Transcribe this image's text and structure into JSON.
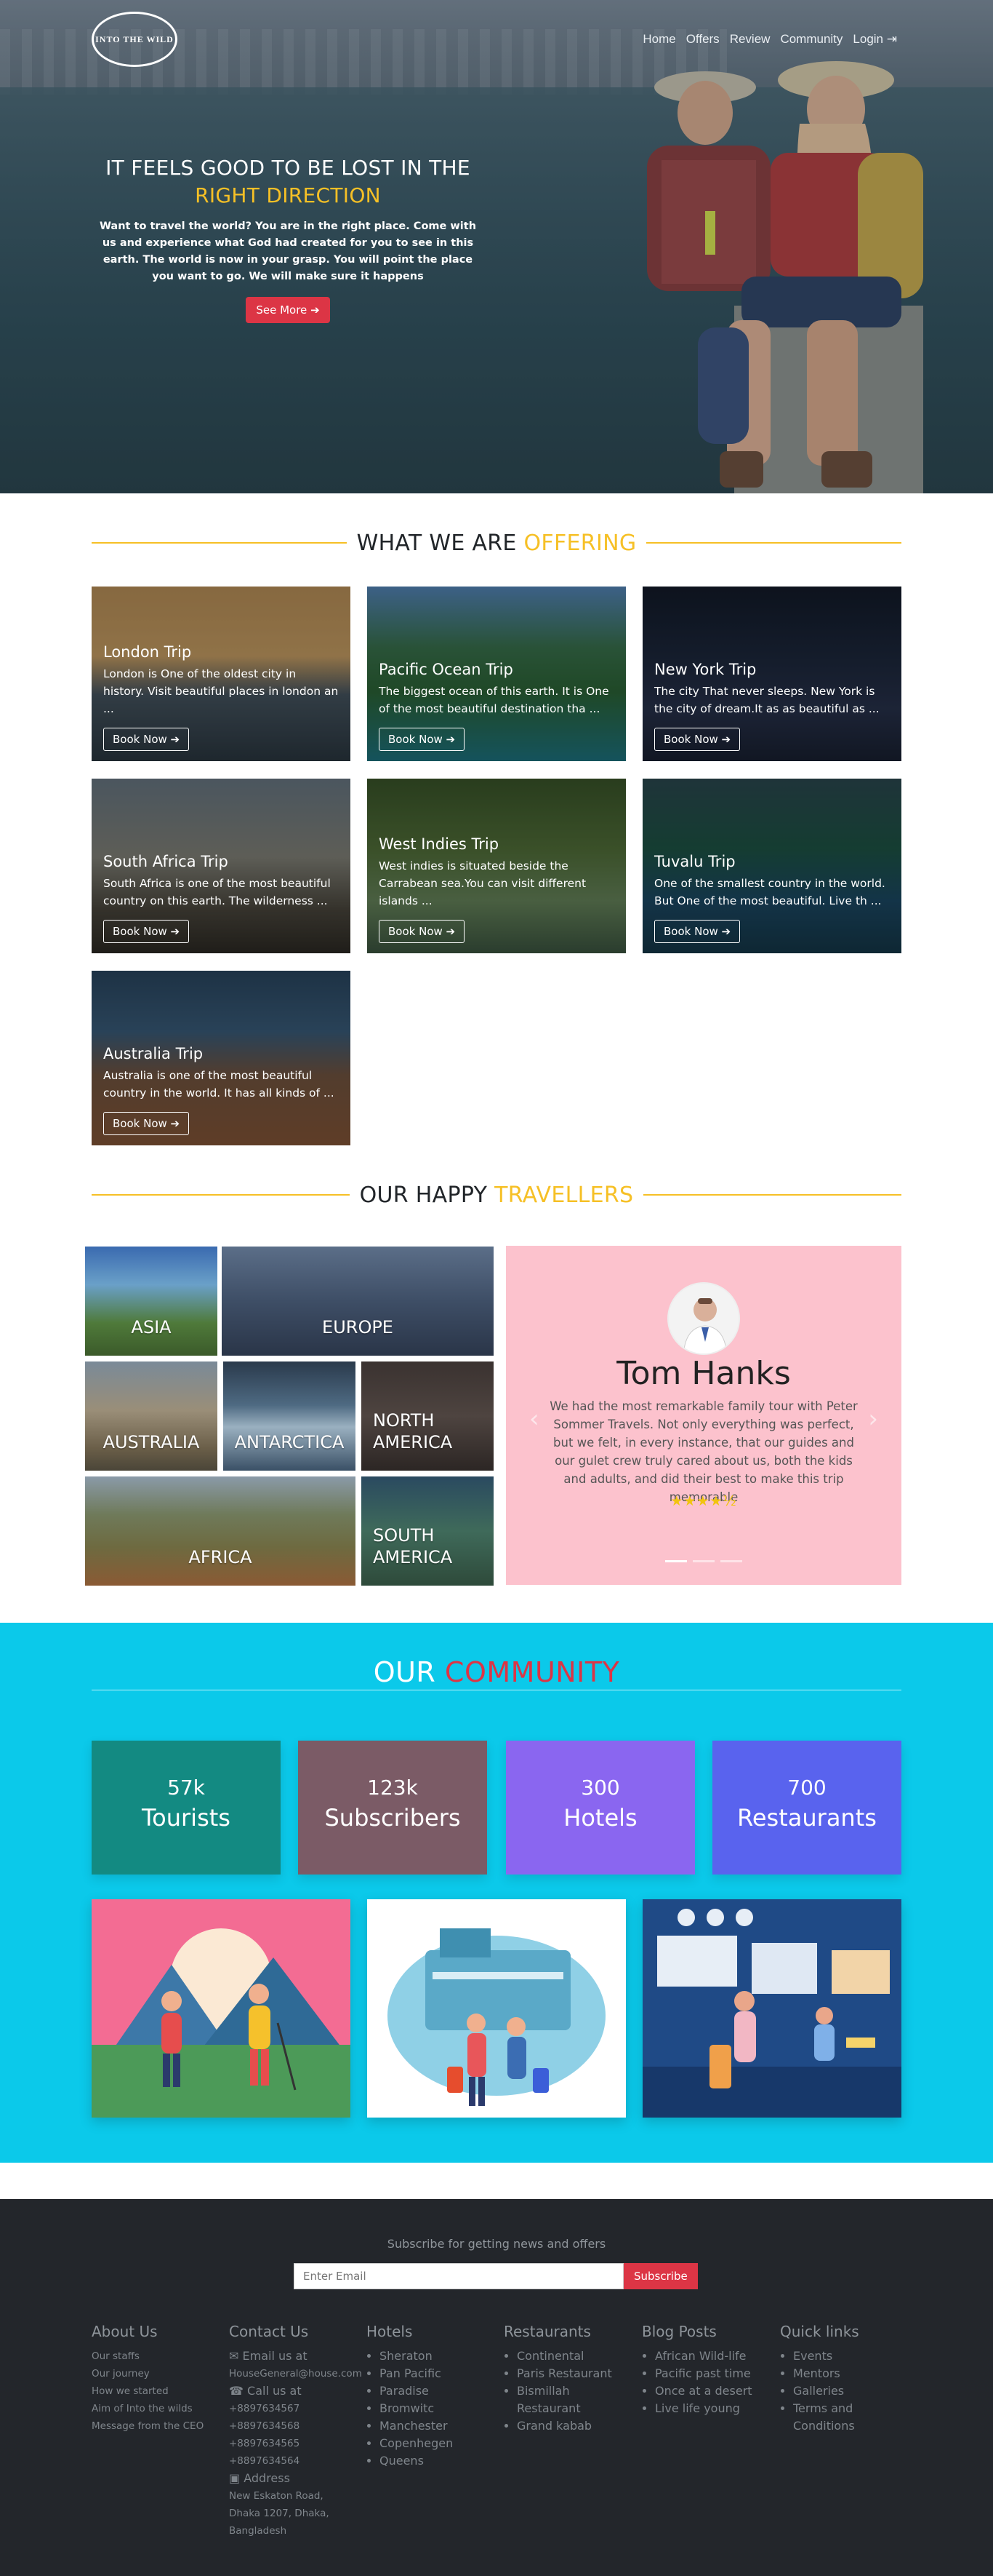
{
  "brand": {
    "logo_text": "INTO THE WILD"
  },
  "nav": {
    "items": [
      "Home",
      "Offers",
      "Review",
      "Community"
    ],
    "login": "Login"
  },
  "hero": {
    "title_line1": "IT FEELS GOOD TO BE LOST IN THE",
    "title_line2": "RIGHT DIRECTION",
    "description": "Want to travel the world? You are in the right place. Come with us and experience what God had created for you to see in this earth. The world is now in your grasp. You will point the place you want to go. We will make sure it happens",
    "button": "See More"
  },
  "offering": {
    "title_a": "WHAT WE ARE",
    "title_b": "OFFERING",
    "cards": [
      {
        "title": "London Trip",
        "desc": "London is One of the oldest city in history. Visit beautiful places in london an ...",
        "button": "Book Now"
      },
      {
        "title": "Pacific Ocean Trip",
        "desc": "The biggest ocean of this earth. It is One of the most beautiful destination tha ...",
        "button": "Book Now"
      },
      {
        "title": "New York Trip",
        "desc": "The city That never sleeps. New York is the city of dream.It as as beautiful as ...",
        "button": "Book Now"
      },
      {
        "title": "South Africa Trip",
        "desc": "South Africa is one of the most beautiful country on this earth. The wilderness ...",
        "button": "Book Now"
      },
      {
        "title": "West Indies Trip",
        "desc": "West indies is situated beside the Carrabean sea.You can visit different islands ...",
        "button": "Book Now"
      },
      {
        "title": "Tuvalu Trip",
        "desc": "One of the smallest country in the world. But One of the most beautiful. Live th ...",
        "button": "Book Now"
      },
      {
        "title": "Australia Trip",
        "desc": "Australia is one of the most beautiful country in the world. It has all kinds of ...",
        "button": "Book Now"
      }
    ]
  },
  "travellers": {
    "title_a": "OUR HAPPY",
    "title_b": "TRAVELLERS",
    "regions": [
      "ASIA",
      "EUROPE",
      "AUSTRALIA",
      "ANTARCTICA",
      "NORTH AMERICA",
      "AFRICA",
      "SOUTH AMERICA"
    ],
    "testimonial": {
      "name": "Tom Hanks",
      "quote": "We had the most remarkable family tour with Peter Sommer Travels. Not only everything was perfect, but we felt, in every instance, that our guides and our gulet crew truly cared about us, both the kids and adults, and did their best to make this trip memorable",
      "stars": "★★★★½",
      "rating": 4.5
    }
  },
  "community": {
    "title_a": "OUR",
    "title_b": "COMMUNITY",
    "stats": [
      {
        "num": "57k",
        "label": "Tourists",
        "color": "#138a82"
      },
      {
        "num": "123k",
        "label": "Subscribers",
        "color": "#7b5b66"
      },
      {
        "num": "300",
        "label": "Hotels",
        "color": "#8a66f0"
      },
      {
        "num": "700",
        "label": "Restaurants",
        "color": "#5963ee"
      }
    ]
  },
  "footer": {
    "subscribe_label": "Subscribe for getting news and offers",
    "email_placeholder": "Enter Email",
    "subscribe_button": "Subscribe",
    "about": {
      "title": "About Us",
      "links": [
        "Our staffs",
        "Our journey",
        "How we started",
        "Aim of Into the wilds",
        "Message from the CEO"
      ]
    },
    "contact": {
      "title": "Contact Us",
      "email_label": "Email us at",
      "email": "HouseGeneral@house.com",
      "call_label": "Call us at",
      "phones": [
        "+8897634567",
        "+8897634568",
        "+8897634565",
        "+8897634564"
      ],
      "address_label": "Address",
      "address": "New Eskaton Road, Dhaka 1207, Dhaka, Bangladesh"
    },
    "hotels": {
      "title": "Hotels",
      "items": [
        "Sheraton",
        "Pan Pacific",
        "Paradise",
        "Bromwitc",
        "Manchester",
        "Copenhegen",
        "Queens"
      ]
    },
    "restaurants": {
      "title": "Restaurants",
      "items": [
        "Continental",
        "Paris Restaurant",
        "Bismillah Restaurant",
        "Grand kabab"
      ]
    },
    "blog": {
      "title": "Blog Posts",
      "items": [
        "African Wild-life",
        "Pacific past time",
        "Once at a desert",
        "Live life young"
      ]
    },
    "quick": {
      "title": "Quick links",
      "items": [
        "Events",
        "Mentors",
        "Galleries",
        "Terms and Conditions"
      ]
    }
  },
  "colors": {
    "accent_gold": "#f6c026",
    "accent_red": "#dc3545",
    "community_bg": "#0bc9ea",
    "footer_bg": "#23262b",
    "testimonial_bg": "#fcc2cd"
  }
}
